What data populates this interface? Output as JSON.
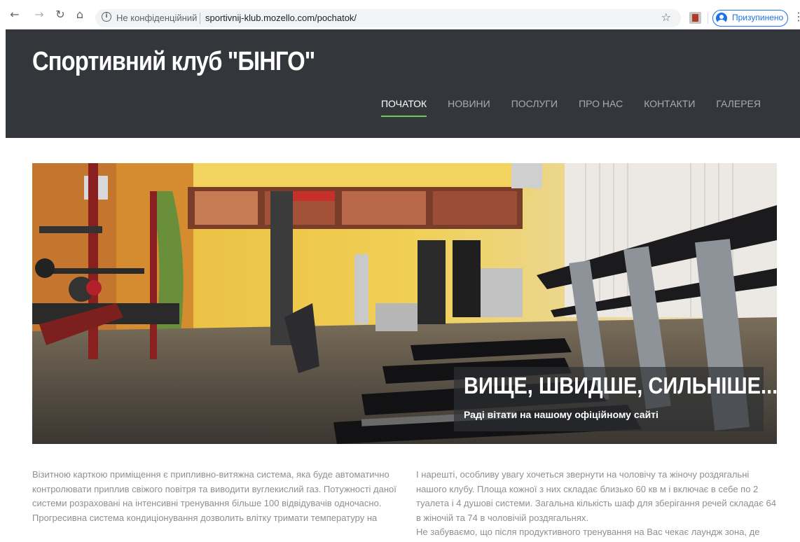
{
  "browser": {
    "back_icon": "arrow-left-icon",
    "forward_icon": "arrow-right-icon",
    "reload_icon": "reload-icon",
    "home_icon": "home-icon",
    "security_label": "Не конфіденційний",
    "url": "sportivnij-klub.mozello.com/pochatok/",
    "profile_label": "Призупинено"
  },
  "site": {
    "title": "Спортивний клуб \"БІНГО\"",
    "nav": [
      {
        "label": "ПОЧАТОК",
        "active": true
      },
      {
        "label": "НОВИНИ"
      },
      {
        "label": "ПОСЛУГИ"
      },
      {
        "label": "ПРО НАС"
      },
      {
        "label": "КОНТАКТИ"
      },
      {
        "label": "ГАЛЕРЕЯ"
      }
    ]
  },
  "hero": {
    "heading": "ВИЩЕ, ШВИДШЕ, СИЛЬНІШЕ...",
    "subtitle": "Раді вітати на нашому офіційному сайті"
  },
  "content": {
    "left": {
      "p1": "Візитною карткою приміщення є припливно-витяжна система, яка буде автоматично контролювати приплив свіжого повітря та виводити вуглекислий газ. Потужності даної системи розраховані на інтенсивні тренування більше 100 відвідувачів одночасно.",
      "p2": "Прогресивна система кондиціонування дозволить влітку тримати температуру на"
    },
    "right": {
      "p1": "І нарешті, особливу увагу хочеться звернути на чоловічу та жіночу роздягальні нашого клубу. Площа кожної з них складає близько 60 кв м і включає в себе по 2 туалета і 4 душові системи. Загальна кількість шаф для зберігання речей складає 64 в жіночій та 74 в чоловічій роздягальнях.",
      "p2": "Не забуваємо, що після продуктивного тренування на Вас чекає лаундж зона, де"
    }
  },
  "colors": {
    "header_bg": "#33373b",
    "nav_active_underline": "#6ecb5a",
    "accent_blue": "#1a73e8"
  }
}
